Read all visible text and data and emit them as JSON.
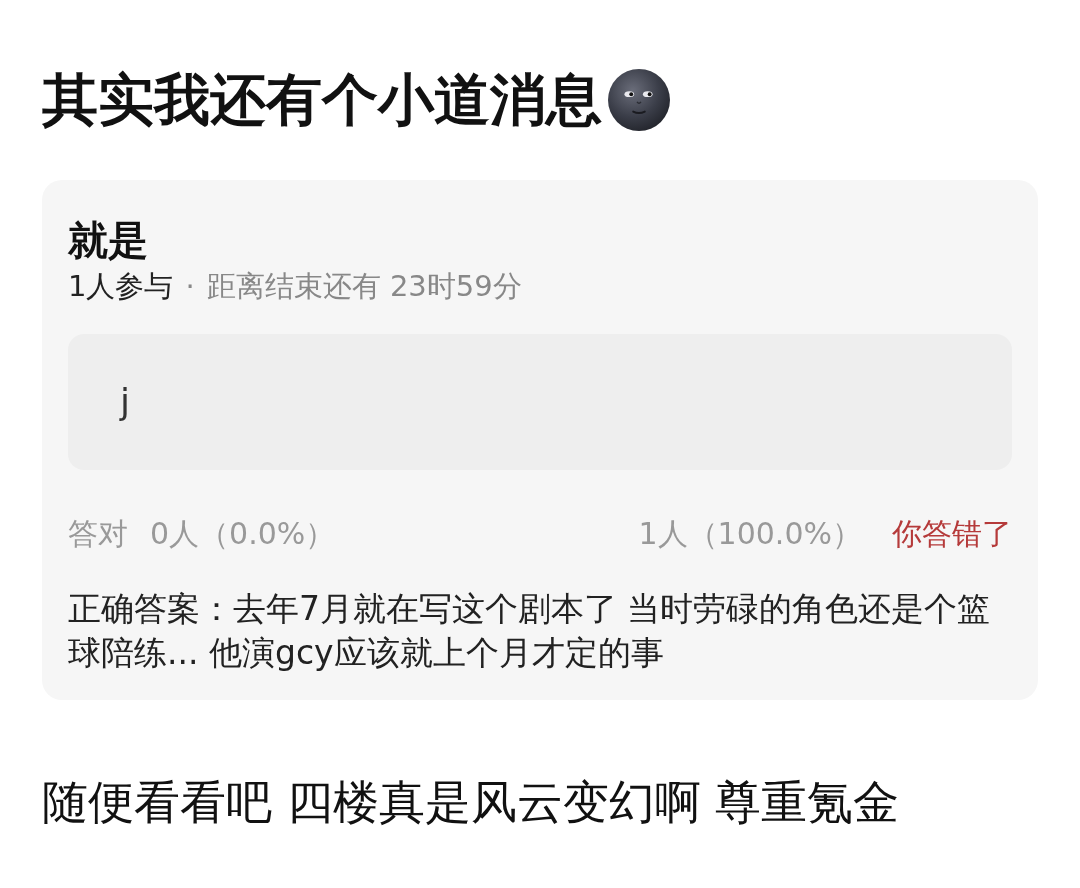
{
  "post": {
    "title": "其实我还有个小道消息"
  },
  "quiz": {
    "title": "就是",
    "participants": "1人参与",
    "separator": "·",
    "time_left": "距离结束还有 23时59分",
    "option": "j",
    "result": {
      "correct_label": "答对",
      "correct_count": "0人（0.0%）",
      "your_count": "1人（100.0%）",
      "verdict": {
        "text": "你答错了",
        "correct": false
      }
    },
    "answer": "正确答案：去年7月就在写这个剧本了 当时劳碌的角色还是个篮球陪练... 他演gcy应该就上个月才定的事"
  },
  "comment": "随便看看吧 四楼真是风云变幻啊 尊重氪金"
}
